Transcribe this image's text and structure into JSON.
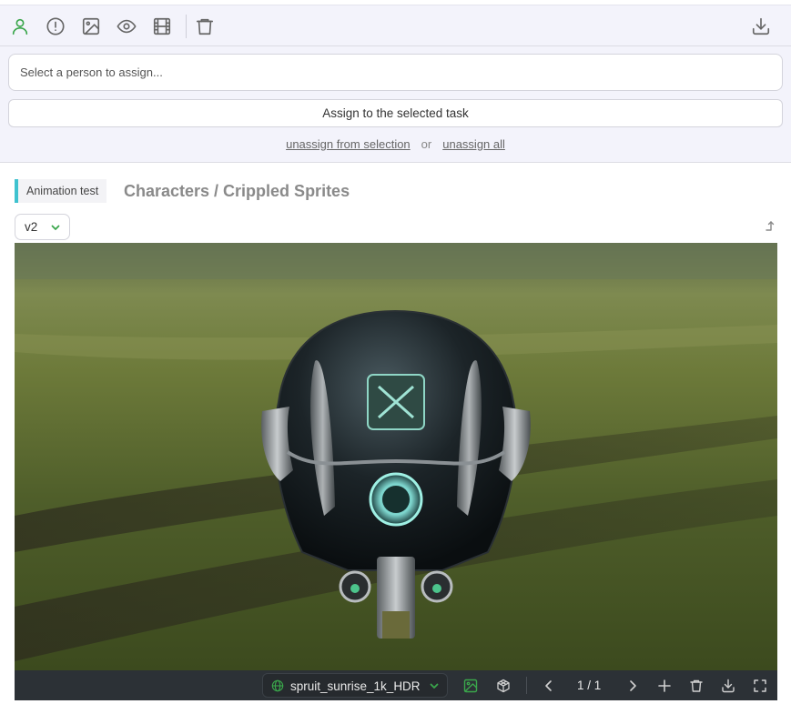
{
  "toolbar": {
    "icons": [
      "person-icon",
      "alert-circle-icon",
      "image-icon",
      "eye-icon",
      "film-icon",
      "trash-icon",
      "download-icon"
    ],
    "active_color": "#3aa64b"
  },
  "assign": {
    "placeholder": "Select a person to assign...",
    "button_label": "Assign to the selected task",
    "unassign_selection": "unassign from selection",
    "or": "or",
    "unassign_all": "unassign all"
  },
  "task": {
    "type": "Animation test",
    "title": "Characters / Crippled Sprites",
    "type_color": "#3fc2cf"
  },
  "version": {
    "selected": "v2"
  },
  "viewer": {
    "environment": "spruit_sunrise_1k_HDR",
    "page": "1 / 1",
    "accent": "#3aa64b"
  }
}
